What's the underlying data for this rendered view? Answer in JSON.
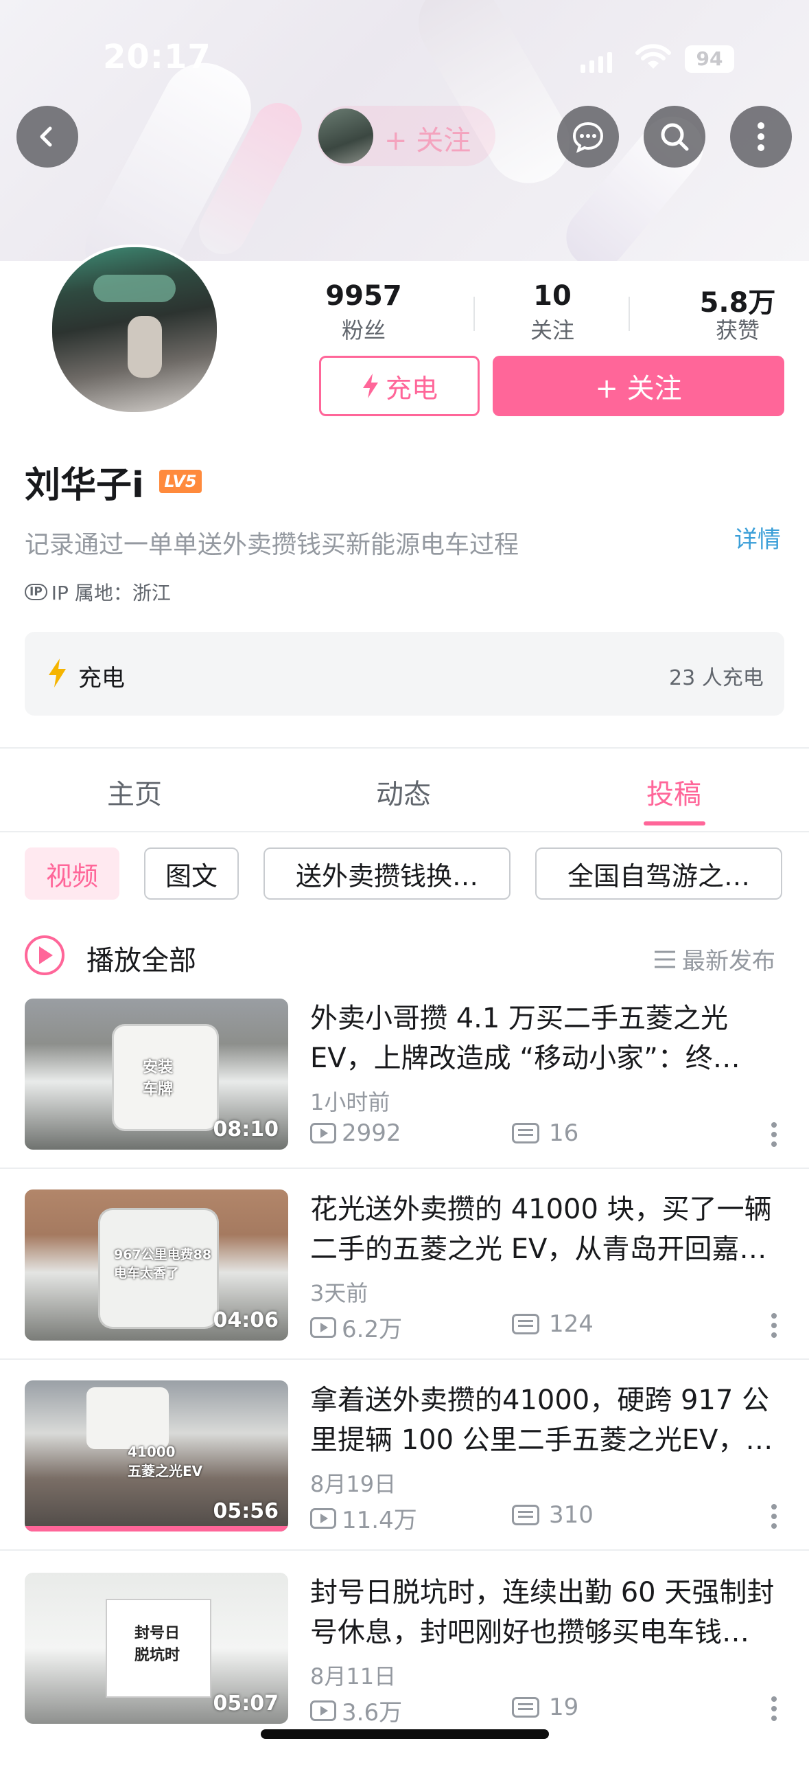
{
  "status_bar": {
    "time": "20:17",
    "battery": "94"
  },
  "nav": {
    "follow_label": "+ 关注"
  },
  "profile": {
    "stats": [
      {
        "value": "9957",
        "label": "粉丝"
      },
      {
        "value": "10",
        "label": "关注"
      },
      {
        "value": "5.8万",
        "label": "获赞"
      }
    ],
    "charge_button": "充电",
    "follow_button": "+ 关注",
    "name": "刘华子i",
    "level": "LV5",
    "bio": "记录通过一单单送外卖攒钱买新能源电车过程",
    "detail_link": "详情",
    "ip_icon": "IP",
    "ip_location": "IP 属地：浙江"
  },
  "charge_panel": {
    "label": "充电",
    "count": "23 人充电"
  },
  "tabs": [
    {
      "label": "主页",
      "active": false
    },
    {
      "label": "动态",
      "active": false
    },
    {
      "label": "投稿",
      "active": true
    }
  ],
  "chips": [
    "视频",
    "图文",
    "送外卖攒钱换…",
    "全国自驾游之…"
  ],
  "list_header": {
    "play_all": "播放全部",
    "sort": "最新发布"
  },
  "videos": [
    {
      "title_line1": "外卖小哥攒 4.1 万买二手五菱之光",
      "title_line2": "EV，上牌改造成 “移动小家”：终…",
      "date": "1小时前",
      "plays": "2992",
      "danmaku": "16",
      "duration": "08:10",
      "thumb_text": "安装\n车牌",
      "watched": 0
    },
    {
      "title_line1": "花光送外卖攒的 41000 块，买了一辆",
      "title_line2": "二手的五菱之光 EV，从青岛开回嘉…",
      "date": "3天前",
      "plays": "6.2万",
      "danmaku": "124",
      "duration": "04:06",
      "thumb_text": "967公里电费88\n电车太香了",
      "watched": 0
    },
    {
      "title_line1": "拿着送外卖攒的41000，硬跨 917 公",
      "title_line2": "里提辆 100 公里二手五菱之光EV，…",
      "date": "8月19日",
      "plays": "11.4万",
      "danmaku": "310",
      "duration": "05:56",
      "thumb_text": "41000\n五菱之光EV",
      "watched": 1
    },
    {
      "title_line1": "封号日脱坑时，连续出勤 60 天强制封",
      "title_line2": "号休息，封吧刚好也攒够买电车钱…",
      "date": "8月11日",
      "plays": "3.6万",
      "danmaku": "19",
      "duration": "05:07",
      "thumb_text": "封号日\n脱坑时",
      "watched": 0
    }
  ],
  "colors": {
    "accent": "#ff6699",
    "link": "#3b9fd8",
    "muted": "#9499a0"
  },
  "icons": {
    "back": "back-icon",
    "message": "message-icon",
    "search": "search-icon",
    "more": "more-icon",
    "charge": "lightning-icon",
    "play_all": "play-circle-icon",
    "sort": "sort-icon"
  }
}
